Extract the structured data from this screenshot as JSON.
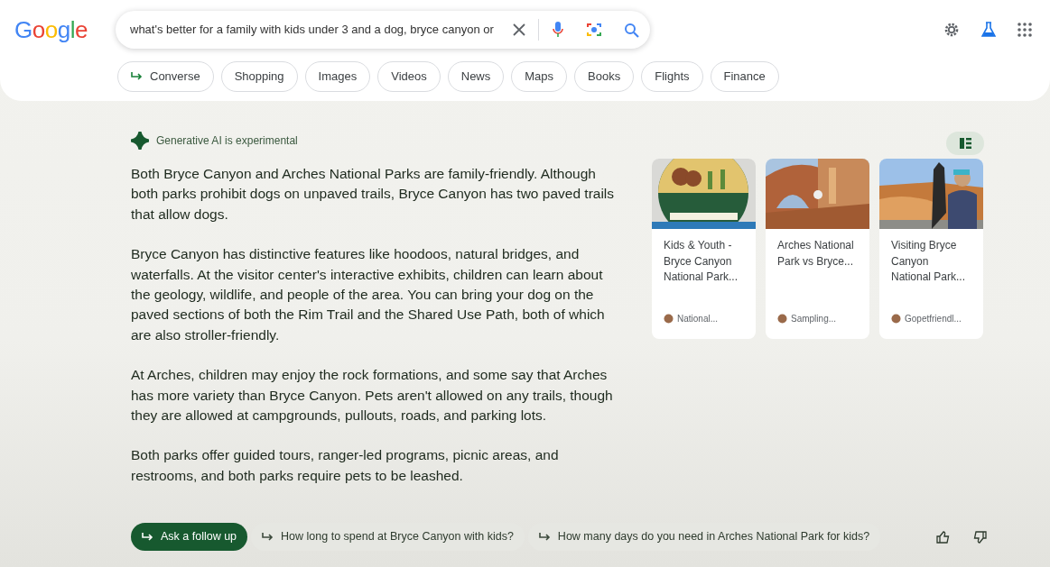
{
  "logo": "Google",
  "search": {
    "value": "what's better for a family with kids under 3 and a dog, bryce canyon or"
  },
  "chips": [
    {
      "label": "Converse",
      "kind": "arrow"
    },
    {
      "label": "Shopping",
      "kind": "plain"
    },
    {
      "label": "Images",
      "kind": "plain"
    },
    {
      "label": "Videos",
      "kind": "plain"
    },
    {
      "label": "News",
      "kind": "plain"
    },
    {
      "label": "Maps",
      "kind": "plain"
    },
    {
      "label": "Books",
      "kind": "plain"
    },
    {
      "label": "Flights",
      "kind": "plain"
    },
    {
      "label": "Finance",
      "kind": "plain"
    }
  ],
  "notice": "Generative AI is experimental",
  "paragraphs": [
    "Both Bryce Canyon and Arches National Parks are family-friendly. Although both parks prohibit dogs on unpaved trails, Bryce Canyon has two paved trails that allow dogs.",
    "Bryce Canyon has distinctive features like hoodoos, natural bridges, and waterfalls. At the visitor center's interactive exhibits, children can learn about the geology, wildlife, and people of the area. You can bring your dog on the paved sections of both the Rim Trail and the Shared Use Path, both of which are also stroller-friendly.",
    "At Arches, children may enjoy the rock formations, and some say that Arches has more variety than Bryce Canyon. Pets aren't allowed on any trails, though they are allowed at campgrounds, pullouts, roads, and parking lots.",
    "Both parks offer guided tours, ranger-led programs, picnic areas, and restrooms, and both parks require pets to be leashed."
  ],
  "sources": [
    {
      "title": "Kids & Youth - Bryce Canyon National Park...",
      "site": "National..."
    },
    {
      "title": "Arches National Park vs Bryce...",
      "site": "Sampling..."
    },
    {
      "title": "Visiting Bryce Canyon National Park...",
      "site": "Gopetfriendl..."
    }
  ],
  "followups": [
    {
      "label": "Ask a follow up",
      "kind": "primary"
    },
    {
      "label": "How long to spend at Bryce Canyon with kids?",
      "kind": "suggestion"
    },
    {
      "label": "How many days do you need in Arches National Park for kids?",
      "kind": "suggestion"
    }
  ]
}
